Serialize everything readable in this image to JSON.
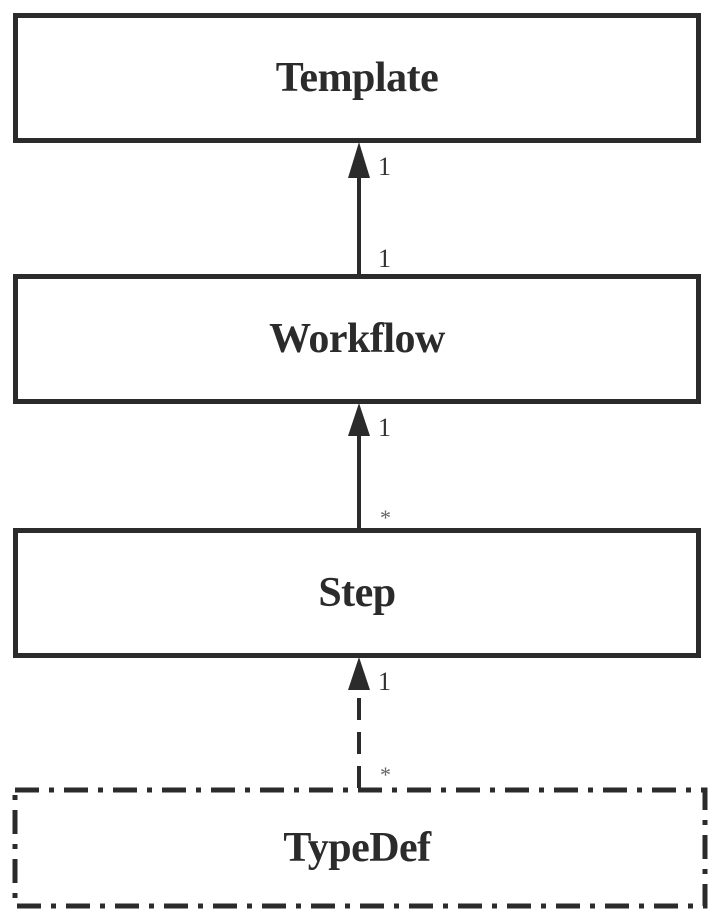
{
  "diagram": {
    "type": "uml-class-hierarchy",
    "classes": [
      {
        "id": "template",
        "name": "Template",
        "style": "solid"
      },
      {
        "id": "workflow",
        "name": "Workflow",
        "style": "solid"
      },
      {
        "id": "step",
        "name": "Step",
        "style": "solid"
      },
      {
        "id": "typedef",
        "name": "TypeDef",
        "style": "dash-dot"
      }
    ],
    "associations": [
      {
        "from": "workflow",
        "to": "template",
        "line": "solid",
        "target_multiplicity": "1",
        "source_multiplicity": "1"
      },
      {
        "from": "step",
        "to": "workflow",
        "line": "solid",
        "target_multiplicity": "1",
        "source_multiplicity": "*"
      },
      {
        "from": "typedef",
        "to": "step",
        "line": "dashed",
        "target_multiplicity": "1",
        "source_multiplicity": "*"
      }
    ],
    "colors": {
      "stroke": "#2b2b2b",
      "text": "#2b2b2b"
    }
  }
}
